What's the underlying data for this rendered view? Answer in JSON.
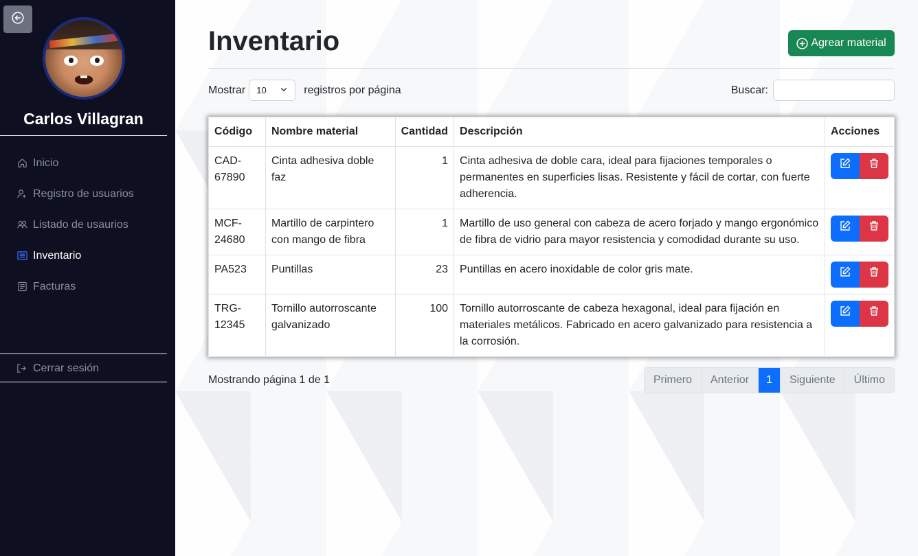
{
  "sidebar": {
    "user_name": "Carlos Villagran",
    "items": [
      {
        "label": "Inicio",
        "icon": "home-icon",
        "active": false
      },
      {
        "label": "Registro de usuarios",
        "icon": "user-add-icon",
        "active": false
      },
      {
        "label": "Listado de usaurios",
        "icon": "users-icon",
        "active": false
      },
      {
        "label": "Inventario",
        "icon": "list-icon",
        "active": true
      },
      {
        "label": "Facturas",
        "icon": "invoice-icon",
        "active": false
      }
    ],
    "logout_label": "Cerrar sesión"
  },
  "header": {
    "title": "Inventario",
    "add_label": "Agrear material"
  },
  "controls": {
    "show_label": "Mostrar",
    "page_size": "10",
    "per_page_label": "registros por página",
    "search_label": "Buscar:",
    "search_value": ""
  },
  "table": {
    "headers": [
      "Código",
      "Nombre material",
      "Cantidad",
      "Descripción",
      "Acciones"
    ],
    "rows": [
      {
        "code": "CAD-67890",
        "name": "Cinta adhesiva doble faz",
        "qty": "1",
        "desc": "Cinta adhesiva de doble cara, ideal para fijaciones temporales o permanentes en superficies lisas. Resistente y fácil de cortar, con fuerte adherencia."
      },
      {
        "code": "MCF-24680",
        "name": "Martillo de carpintero con mango de fibra",
        "qty": "1",
        "desc": "Martillo de uso general con cabeza de acero forjado y mango ergonómico de fibra de vidrio para mayor resistencia y comodidad durante su uso."
      },
      {
        "code": "PA523",
        "name": "Puntillas",
        "qty": "23",
        "desc": "Puntillas en acero inoxidable de color gris mate."
      },
      {
        "code": "TRG-12345",
        "name": "Tornillo autorroscante galvanizado",
        "qty": "100",
        "desc": "Tornillo autorroscante de cabeza hexagonal, ideal para fijación en materiales metálicos. Fabricado en acero galvanizado para resistencia a la corrosión."
      }
    ]
  },
  "footer": {
    "info": "Mostrando página 1 de 1",
    "pagination": [
      "Primero",
      "Anterior",
      "1",
      "Siguiente",
      "Último"
    ],
    "active_page": "1"
  },
  "colors": {
    "sidebar_bg": "#0e1022",
    "add_button": "#198754",
    "edit_button": "#0d6efd",
    "delete_button": "#dc3545"
  }
}
